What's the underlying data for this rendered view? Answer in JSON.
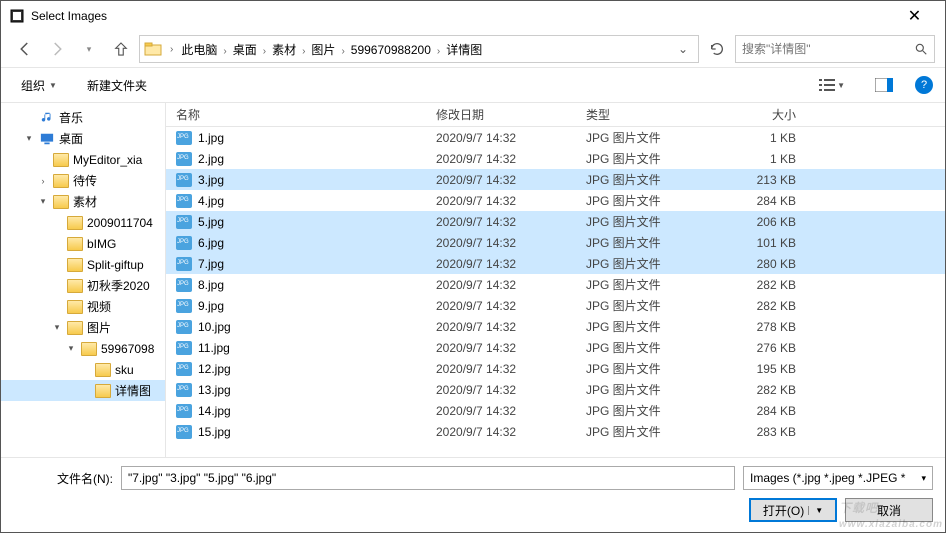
{
  "window": {
    "title": "Select Images"
  },
  "breadcrumb": {
    "items": [
      "此电脑",
      "桌面",
      "素材",
      "图片",
      "599670988200",
      "详情图"
    ],
    "search_placeholder": "搜索\"详情图\""
  },
  "toolbar": {
    "organize": "组织",
    "new_folder": "新建文件夹"
  },
  "tree": [
    {
      "label": "音乐",
      "indent": 1,
      "icon": "music",
      "exp": ""
    },
    {
      "label": "桌面",
      "indent": 1,
      "icon": "desktop",
      "exp": "▾"
    },
    {
      "label": "MyEditor_xia",
      "indent": 2,
      "icon": "folder",
      "exp": ""
    },
    {
      "label": "待传",
      "indent": 2,
      "icon": "folder",
      "exp": "›"
    },
    {
      "label": "素材",
      "indent": 2,
      "icon": "folder",
      "exp": "▾"
    },
    {
      "label": "2009011704",
      "indent": 3,
      "icon": "folder",
      "exp": ""
    },
    {
      "label": "bIMG",
      "indent": 3,
      "icon": "folder",
      "exp": ""
    },
    {
      "label": "Split-giftup",
      "indent": 3,
      "icon": "folder",
      "exp": ""
    },
    {
      "label": "初秋季2020",
      "indent": 3,
      "icon": "folder",
      "exp": ""
    },
    {
      "label": "视频",
      "indent": 3,
      "icon": "folder",
      "exp": ""
    },
    {
      "label": "图片",
      "indent": 3,
      "icon": "folder",
      "exp": "▾"
    },
    {
      "label": "59967098",
      "indent": 4,
      "icon": "folder",
      "exp": "▾"
    },
    {
      "label": "sku",
      "indent": 5,
      "icon": "folder",
      "exp": ""
    },
    {
      "label": "详情图",
      "indent": 5,
      "icon": "folder",
      "exp": "",
      "selected": true
    }
  ],
  "columns": {
    "name": "名称",
    "date": "修改日期",
    "type": "类型",
    "size": "大小"
  },
  "files": [
    {
      "name": "1.jpg",
      "date": "2020/9/7 14:32",
      "type": "JPG 图片文件",
      "size": "1 KB",
      "selected": false
    },
    {
      "name": "2.jpg",
      "date": "2020/9/7 14:32",
      "type": "JPG 图片文件",
      "size": "1 KB",
      "selected": false
    },
    {
      "name": "3.jpg",
      "date": "2020/9/7 14:32",
      "type": "JPG 图片文件",
      "size": "213 KB",
      "selected": true
    },
    {
      "name": "4.jpg",
      "date": "2020/9/7 14:32",
      "type": "JPG 图片文件",
      "size": "284 KB",
      "selected": false
    },
    {
      "name": "5.jpg",
      "date": "2020/9/7 14:32",
      "type": "JPG 图片文件",
      "size": "206 KB",
      "selected": true
    },
    {
      "name": "6.jpg",
      "date": "2020/9/7 14:32",
      "type": "JPG 图片文件",
      "size": "101 KB",
      "selected": true
    },
    {
      "name": "7.jpg",
      "date": "2020/9/7 14:32",
      "type": "JPG 图片文件",
      "size": "280 KB",
      "selected": true
    },
    {
      "name": "8.jpg",
      "date": "2020/9/7 14:32",
      "type": "JPG 图片文件",
      "size": "282 KB",
      "selected": false
    },
    {
      "name": "9.jpg",
      "date": "2020/9/7 14:32",
      "type": "JPG 图片文件",
      "size": "282 KB",
      "selected": false
    },
    {
      "name": "10.jpg",
      "date": "2020/9/7 14:32",
      "type": "JPG 图片文件",
      "size": "278 KB",
      "selected": false
    },
    {
      "name": "11.jpg",
      "date": "2020/9/7 14:32",
      "type": "JPG 图片文件",
      "size": "276 KB",
      "selected": false
    },
    {
      "name": "12.jpg",
      "date": "2020/9/7 14:32",
      "type": "JPG 图片文件",
      "size": "195 KB",
      "selected": false
    },
    {
      "name": "13.jpg",
      "date": "2020/9/7 14:32",
      "type": "JPG 图片文件",
      "size": "282 KB",
      "selected": false
    },
    {
      "name": "14.jpg",
      "date": "2020/9/7 14:32",
      "type": "JPG 图片文件",
      "size": "284 KB",
      "selected": false
    },
    {
      "name": "15.jpg",
      "date": "2020/9/7 14:32",
      "type": "JPG 图片文件",
      "size": "283 KB",
      "selected": false
    }
  ],
  "bottom": {
    "filename_label": "文件名(N):",
    "filename_value": "\"7.jpg\" \"3.jpg\" \"5.jpg\" \"6.jpg\"",
    "filter": "Images (*.jpg *.jpeg *.JPEG *",
    "open": "打开(O)",
    "cancel": "取消"
  },
  "watermark": {
    "main": "下载吧",
    "sub": "www.xiazaiba.com"
  }
}
